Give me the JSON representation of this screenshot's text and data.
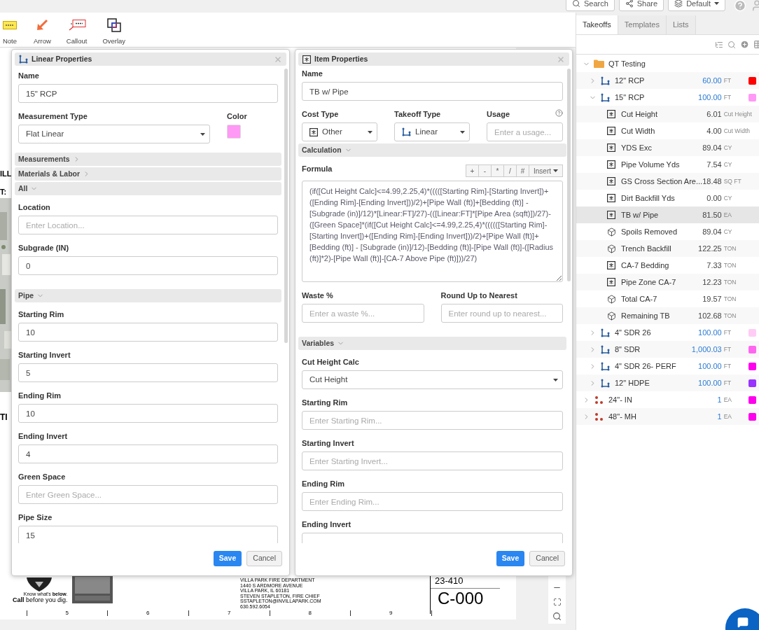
{
  "top_bar": {
    "buttons": [
      {
        "label": "Search"
      },
      {
        "label": "Share"
      },
      {
        "label": "Default",
        "dropdown": true
      }
    ]
  },
  "toolbar": {
    "tools": [
      "Note",
      "Arrow",
      "Callout",
      "Overlay"
    ]
  },
  "sheet": {
    "fragments": [
      "ILL",
      "T:",
      "TI"
    ],
    "dig_logo": {
      "line_1": "Know what's **below**.",
      "line_2": "**Call** before you dig."
    },
    "contact_lines": [
      "VILLA PARK FIRE DEPARTMENT",
      "1440 S ARDMORE AVENUE",
      "VILLA PARK, IL 60181",
      "STEVEN STAPLETON, FIRE CHIEF",
      "SSTAPLETON@INVILLAPARK.COM",
      "630.592.6054"
    ],
    "project_number": "23-410",
    "sheet_number": "C-000",
    "scale_labels": [
      "5",
      "6",
      "7",
      "8",
      "9"
    ]
  },
  "linear_properties": {
    "title": "Linear Properties",
    "name": {
      "label": "Name",
      "value": "15\" RCP"
    },
    "measurement_type": {
      "label": "Measurement Type",
      "value": "Flat Linear"
    },
    "color": {
      "label": "Color",
      "color": "#ff99f5"
    },
    "sections": [
      {
        "title": "Measurements",
        "expanded": false
      },
      {
        "title": "Materials & Labor",
        "expanded": false
      },
      {
        "title": "All",
        "expanded": true,
        "fields": [
          {
            "label": "Location",
            "placeholder": "Enter Location..."
          },
          {
            "label": "Subgrade (IN)",
            "value": "0"
          }
        ]
      },
      {
        "title": "Pipe",
        "expanded": true,
        "fields": [
          {
            "label": "Starting Rim",
            "value": "10"
          },
          {
            "label": "Starting Invert",
            "value": "5"
          },
          {
            "label": "Ending Rim",
            "value": "10"
          },
          {
            "label": "Ending Invert",
            "value": "4"
          },
          {
            "label": "Green Space",
            "placeholder": "Enter Green Space..."
          },
          {
            "label": "Pipe Size",
            "value": "15"
          }
        ]
      }
    ],
    "buttons": [
      "Save",
      "Cancel"
    ]
  },
  "item_properties": {
    "title": "Item Properties",
    "name": {
      "label": "Name",
      "value": "TB w/ Pipe"
    },
    "cost_type": {
      "label": "Cost Type",
      "value": "Other"
    },
    "takeoff_type": {
      "label": "Takeoff Type",
      "value": "Linear"
    },
    "usage": {
      "label": "Usage",
      "placeholder": "Enter a usage..."
    },
    "sections": [
      {
        "kind": "calculation",
        "title": "Calculation",
        "expanded": true,
        "formula": {
          "label": "Formula",
          "operators": [
            "+",
            "-",
            "*",
            "/",
            "#"
          ],
          "insert": "Insert",
          "value": "(if([Cut Height Calc]<=4.99,2.25,4)*(((([Starting Rim]-[Starting Invert])+([Ending Rim]-[Ending Invert]))/2)+[Pipe Wall (ft)]+[Bedding (ft)] - [Subgrade (in)]/12)*[Linear:FT]/27)-(([Linear:FT]*[Pipe Area (sqft)])/27)-([Green Space]*(if([Cut Height Calc]<=4.99,2.25,4)*((((([Starting Rim]-[Starting Invert])+([Ending Rim]-[Ending Invert]))/2)+[Pipe Wall (ft)]+[Bedding (ft)] - [Subgrade (in)]/12)-[Bedding (ft)]-[Pipe Wall (ft)]-([Radius (ft)]*2)-[Pipe Wall (ft)]-[CA-7 Above Pipe (ft)]))/27)"
        },
        "waste": {
          "label": "Waste %",
          "placeholder": "Enter a waste %..."
        },
        "round_up": {
          "label": "Round Up to Nearest",
          "placeholder": "Enter round up to nearest..."
        }
      },
      {
        "kind": "fields",
        "title": "Variables",
        "expanded": true,
        "fields": [
          {
            "kind": "select",
            "label": "Cut Height Calc",
            "value": "Cut Height"
          },
          {
            "label": "Starting Rim",
            "placeholder": "Enter Starting Rim..."
          },
          {
            "label": "Starting Invert",
            "placeholder": "Enter Starting Invert..."
          },
          {
            "label": "Ending Rim",
            "placeholder": "Enter Ending Rim..."
          },
          {
            "label": "Ending Invert"
          }
        ]
      }
    ],
    "buttons": [
      "Save",
      "Cancel"
    ]
  },
  "tabs": [
    {
      "label": "Takeoffs",
      "selected": true
    },
    {
      "label": "Templates",
      "selected": false
    },
    {
      "label": "Lists",
      "selected": false
    }
  ],
  "tree": [
    {
      "kind": "folder",
      "label": "QT Testing",
      "expanded": true,
      "selected": false,
      "children": [
        {
          "kind": "linear",
          "label": "12\" RCP",
          "value": "60.00",
          "unit": "FT",
          "color": "#ff0000",
          "expanded": false,
          "selected": false
        },
        {
          "kind": "linear",
          "label": "15\" RCP",
          "value": "100.00",
          "unit": "FT",
          "color": "#ff99f5",
          "expanded": true,
          "selected": false,
          "children": [
            {
              "kind": "item",
              "label": "Cut Height",
              "value": "6.01",
              "unit": "Cut Height",
              "selected": false
            },
            {
              "kind": "item",
              "label": "Cut Width",
              "value": "4.00",
              "unit": "Cut Width",
              "selected": false
            },
            {
              "kind": "item",
              "label": "YDS Exc",
              "value": "89.04",
              "unit": "CY",
              "selected": false
            },
            {
              "kind": "item",
              "label": "Pipe Volume Yds",
              "value": "7.54",
              "unit": "CY",
              "selected": false
            },
            {
              "kind": "item",
              "label": "GS Cross Section Are...",
              "value": "18.48",
              "unit": "SQ FT",
              "selected": false
            },
            {
              "kind": "item",
              "label": "Dirt Backfill Yds",
              "value": "0.00",
              "unit": "CY",
              "selected": false
            },
            {
              "kind": "item",
              "label": "TB w/ Pipe",
              "value": "81.50",
              "unit": "EA",
              "selected": true
            },
            {
              "kind": "assembly",
              "label": "Spoils Removed",
              "value": "89.04",
              "unit": "CY",
              "selected": false
            },
            {
              "kind": "assembly",
              "label": "Trench Backfill",
              "value": "122.25",
              "unit": "TON",
              "selected": false
            },
            {
              "kind": "item",
              "label": "CA-7 Bedding",
              "value": "7.33",
              "unit": "TON",
              "selected": false
            },
            {
              "kind": "item",
              "label": "Pipe Zone CA-7",
              "value": "12.23",
              "unit": "TON",
              "selected": false
            },
            {
              "kind": "assembly",
              "label": "Total CA-7",
              "value": "19.57",
              "unit": "TON",
              "selected": false
            },
            {
              "kind": "assembly",
              "label": "Remaining TB",
              "value": "102.68",
              "unit": "TON",
              "selected": false
            }
          ]
        },
        {
          "kind": "linear",
          "label": "4\" SDR 26",
          "value": "100.00",
          "unit": "FT",
          "color": "#ffccf5",
          "expanded": false,
          "selected": false
        },
        {
          "kind": "linear",
          "label": "8\" SDR",
          "value": "1,000.03",
          "unit": "FT",
          "color": "#ff66f0",
          "expanded": false,
          "selected": false
        },
        {
          "kind": "linear",
          "label": "4\" SDR 26- PERF",
          "value": "100.00",
          "unit": "FT",
          "color": "#ff00ee",
          "expanded": false,
          "selected": false
        },
        {
          "kind": "linear",
          "label": "12\" HDPE",
          "value": "100.00",
          "unit": "FT",
          "color": "#9933ff",
          "expanded": false,
          "selected": false
        }
      ]
    },
    {
      "kind": "count",
      "label": "24\"- IN",
      "value": "1",
      "unit": "EA",
      "color": "#ff00ee",
      "expanded": false,
      "selected": false
    },
    {
      "kind": "count",
      "label": "48\"- MH",
      "value": "1",
      "unit": "EA",
      "color": "#ff00ee",
      "expanded": false,
      "selected": false
    }
  ]
}
